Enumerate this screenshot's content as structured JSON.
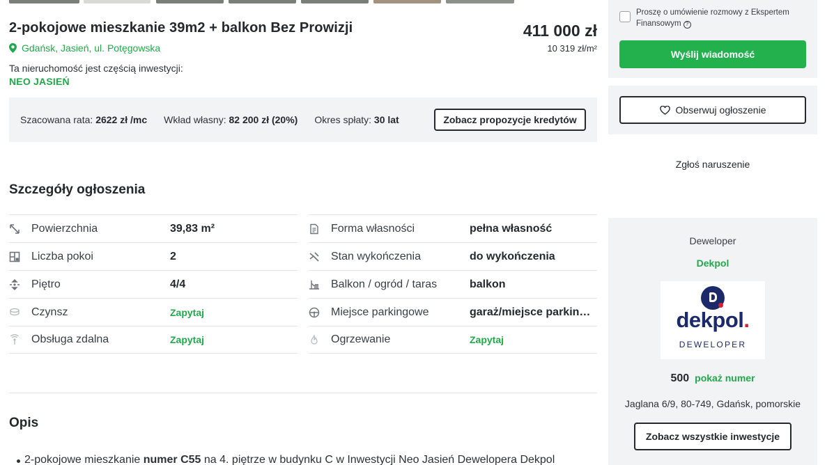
{
  "listing": {
    "title": "2-pokojowe mieszkanie 39m2 + balkon Bez Prowizji",
    "price": "411 000 zł",
    "price_per_m2": "10 319 zł/m²",
    "location": "Gdańsk, Jasień, ul. Potęgowska",
    "investment_label": "Ta nieruchomość jest częścią inwestycji:",
    "investment_name": "NEO JASIEŃ"
  },
  "loan": {
    "rate_label": "Szacowana rata:",
    "rate_value": "2622 zł /mc",
    "down_label": "Wkład własny:",
    "down_value": "82 200 zł (20%)",
    "period_label": "Okres spłaty:",
    "period_value": "30 lat",
    "button": "Zobacz propozycje kredytów"
  },
  "details": {
    "title": "Szczegóły ogłoszenia",
    "left": [
      {
        "icon": "area-icon",
        "label": "Powierzchnia",
        "value": "39,83 m²",
        "ask": false
      },
      {
        "icon": "rooms-icon",
        "label": "Liczba pokoi",
        "value": "2",
        "ask": false
      },
      {
        "icon": "floor-icon",
        "label": "Piętro",
        "value": "4/4",
        "ask": false
      },
      {
        "icon": "rent-icon",
        "label": "Czynsz",
        "value": "Zapytaj",
        "ask": true
      },
      {
        "icon": "remote-service-icon",
        "label": "Obsługa zdalna",
        "value": "Zapytaj",
        "ask": true
      }
    ],
    "right": [
      {
        "icon": "ownership-icon",
        "label": "Forma własności",
        "value": "pełna własność",
        "ask": false
      },
      {
        "icon": "finish-icon",
        "label": "Stan wykończenia",
        "value": "do wykończenia",
        "ask": false
      },
      {
        "icon": "balcony-icon",
        "label": "Balkon / ogród / taras",
        "value": "balkon",
        "ask": false
      },
      {
        "icon": "parking-icon",
        "label": "Miejsce parkingowe",
        "value": "garaż/miejsce parkingowe",
        "ask": false
      },
      {
        "icon": "heating-icon",
        "label": "Ogrzewanie",
        "value": "Zapytaj",
        "ask": true
      }
    ]
  },
  "description": {
    "title": "Opis",
    "first_line_pre": "2-pokojowe mieszkanie ",
    "first_line_bold": "numer C55",
    "first_line_post": " na 4. piętrze w budynku C w Inwestycji Neo Jasień Dewelopera Dekpol"
  },
  "sidebar": {
    "consent_label": "Proszę o umówienie rozmowy z Ekspertem Finansowym",
    "send_button": "Wyślij wiadomość",
    "watch_button": "Obserwuj ogłoszenie",
    "report_link": "Zgłoś naruszenie",
    "developer_label": "Deweloper",
    "developer_name": "Dekpol",
    "logo_text": "dekpol",
    "logo_dot": ".",
    "logo_subtitle": "DEWELOPER",
    "phone_prefix": "500",
    "show_number": "pokaż numer",
    "address": "Jaglana 6/9, 80-749, Gdańsk, pomorskie",
    "all_investments_button": "Zobacz wszystkie inwestycje"
  },
  "colors": {
    "accent_green": "#22a84a",
    "button_green": "#22b14c",
    "text_dark": "#25282d",
    "panel_bg": "#f2f3f5",
    "logo_navy": "#1c2a6b",
    "logo_red": "#d41f36"
  }
}
